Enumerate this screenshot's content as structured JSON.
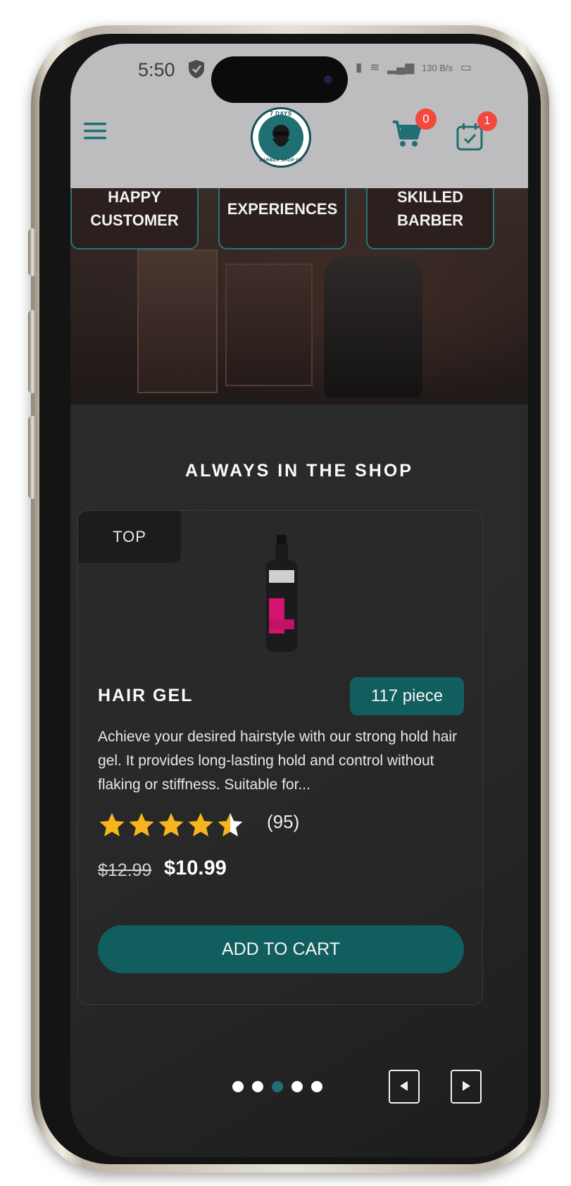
{
  "status_bar": {
    "time": "5:50",
    "net_speed": "130 B/s",
    "icons": [
      "shield-icon",
      "vibrate-icon",
      "wifi-icon",
      "signal-icon",
      "signal-icon",
      "battery-icon"
    ]
  },
  "header": {
    "logo_top_text": "7 DAYS",
    "logo_bottom_text": "BARBER SHOP US",
    "cart_count": "0",
    "appointments_count": "1"
  },
  "hero": {
    "stats": [
      {
        "label_line1": "HAPPY",
        "label_line2": "CUSTOMER"
      },
      {
        "label_line1": "EXPERIENCES",
        "label_line2": ""
      },
      {
        "label_line1": "SKILLED",
        "label_line2": "BARBER"
      }
    ]
  },
  "shop": {
    "section_title": "ALWAYS IN THE SHOP",
    "product": {
      "tag": "TOP",
      "name": "HAIR GEL",
      "stock": "117 piece",
      "description": "Achieve your desired hairstyle with our strong hold hair gel. It provides long-lasting hold and control without flaking or stiffness. Suitable for...",
      "rating": 4.5,
      "rating_count": "(95)",
      "old_price": "$12.99",
      "new_price": "$10.99",
      "add_to_cart_label": "ADD TO CART"
    },
    "carousel": {
      "total": 5,
      "active_index": 2
    }
  },
  "colors": {
    "accent": "#115e5e",
    "badge": "#f2493f",
    "star": "#f5b51f",
    "header_bg": "#bdbcbf",
    "content_bg": "#2a2a2a"
  }
}
